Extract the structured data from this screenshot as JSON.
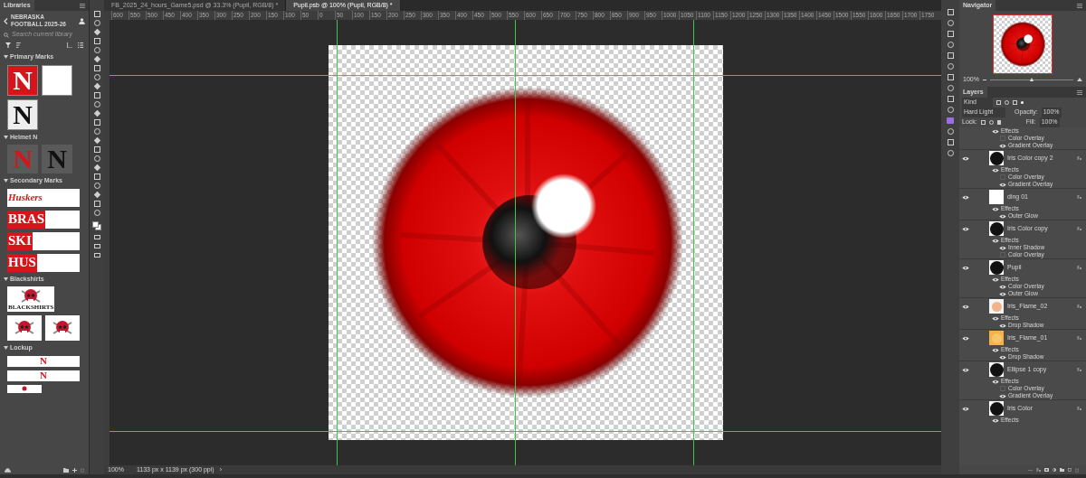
{
  "libraries": {
    "tab": "Libraries",
    "library": "NEBRASKA FOOTBALL 2025-26",
    "search": {
      "placeholder": "Search current library"
    },
    "sections": [
      {
        "title": "Primary Marks",
        "expanded": true,
        "items": [
          {
            "kind": "red-letter",
            "text": "N"
          },
          {
            "kind": "blank"
          },
          {
            "kind": "black-letter",
            "text": "N"
          }
        ]
      },
      {
        "title": "Helmet N",
        "expanded": true,
        "items": [
          {
            "kind": "helmet-red",
            "text": "N"
          },
          {
            "kind": "helmet-black",
            "text": "N"
          }
        ]
      },
      {
        "title": "Secondary Marks",
        "expanded": true,
        "items": [
          {
            "kind": "script",
            "text": "Huskers"
          },
          {
            "kind": "block-word",
            "text": "BRAS"
          },
          {
            "kind": "block-word",
            "text": "SKI"
          },
          {
            "kind": "block-word",
            "text": "HUS"
          }
        ]
      },
      {
        "title": "Blackshirts",
        "expanded": true,
        "items": [
          {
            "kind": "skull",
            "text": "BLACKSHIRTS"
          },
          {
            "kind": "skull"
          },
          {
            "kind": "skull"
          }
        ]
      },
      {
        "title": "Lockup",
        "expanded": true,
        "items": [
          {
            "kind": "lockup",
            "text": "N"
          },
          {
            "kind": "lockup",
            "text": "N"
          },
          {
            "kind": "lockup-small"
          }
        ]
      }
    ]
  },
  "document_tabs": [
    {
      "label": "FB_2025_24_hours_Game5.psd @ 33.3% (Pupil, RGB/8) *",
      "selected": false
    },
    {
      "label": "Pupil.psb @ 100% (Pupil, RGB/8) *",
      "selected": true
    }
  ],
  "ruler": {
    "labels": [
      "600",
      "550",
      "500",
      "450",
      "400",
      "350",
      "300",
      "250",
      "200",
      "150",
      "100",
      "50",
      "0",
      "50",
      "100",
      "150",
      "200",
      "250",
      "300",
      "350",
      "400",
      "450",
      "500",
      "550",
      "600",
      "650",
      "700",
      "750",
      "800",
      "850",
      "900",
      "950",
      "1000",
      "1050",
      "1100",
      "1150",
      "1200",
      "1250",
      "1300",
      "1350",
      "1400",
      "1450",
      "1500",
      "1550",
      "1600",
      "1650",
      "1700",
      "1750"
    ]
  },
  "status_bar": {
    "zoom": "100%",
    "dimensions": "1133 px x 1139 px (300 ppi)",
    "arrow": "›"
  },
  "navigator": {
    "tab": "Navigator",
    "zoom": "100%",
    "level": 0.5
  },
  "layers_panel": {
    "tab": "Layers",
    "filter": "Kind",
    "blend_mode": "Hard Light",
    "opacity_label": "Opacity:",
    "opacity": "100%",
    "lock_label": "Lock:",
    "fill_label": "Fill:",
    "fill": "100%",
    "layers": [
      {
        "effects": [
          {
            "name": "Effects",
            "visible": true
          },
          {
            "name": "Color Overlay",
            "visible": false
          },
          {
            "name": "Gradient Overlay",
            "visible": true
          }
        ]
      },
      {
        "name": "Iris Color copy 2",
        "kind": "black-circle",
        "visible": true,
        "effects": [
          {
            "name": "Effects",
            "visible": true
          },
          {
            "name": "Color Overlay",
            "visible": false
          },
          {
            "name": "Gradient Overlay",
            "visible": true
          }
        ]
      },
      {
        "name": "ding 01",
        "kind": "white",
        "visible": true,
        "effects": [
          {
            "name": "Effects",
            "visible": true
          },
          {
            "name": "Outer Glow",
            "visible": true
          }
        ]
      },
      {
        "name": "Iris Color copy",
        "kind": "black-circle",
        "visible": true,
        "effects": [
          {
            "name": "Effects",
            "visible": true
          },
          {
            "name": "Inner Shadow",
            "visible": true
          },
          {
            "name": "Color Overlay",
            "visible": false
          }
        ]
      },
      {
        "name": "Pupil",
        "kind": "black-circle",
        "visible": true,
        "effects": [
          {
            "name": "Effects",
            "visible": true
          },
          {
            "name": "Color Overlay",
            "visible": true
          },
          {
            "name": "Outer Glow",
            "visible": true
          }
        ]
      },
      {
        "name": "Iris_Flame_02",
        "kind": "flame-faint",
        "visible": true,
        "effects": [
          {
            "name": "Effects",
            "visible": true
          },
          {
            "name": "Drop Shadow",
            "visible": true
          }
        ]
      },
      {
        "name": "Iris_Flame_01",
        "kind": "flame",
        "visible": true,
        "effects": [
          {
            "name": "Effects",
            "visible": true
          },
          {
            "name": "Drop Shadow",
            "visible": true
          }
        ]
      },
      {
        "name": "Ellipse 1 copy",
        "kind": "black-circle",
        "visible": true,
        "effects": [
          {
            "name": "Effects",
            "visible": true
          },
          {
            "name": "Color Overlay",
            "visible": false
          },
          {
            "name": "Gradient Overlay",
            "visible": true
          }
        ]
      },
      {
        "name": "Iris Color",
        "kind": "black-circle",
        "visible": true,
        "effects": [
          {
            "name": "Effects",
            "visible": true
          }
        ]
      }
    ]
  }
}
